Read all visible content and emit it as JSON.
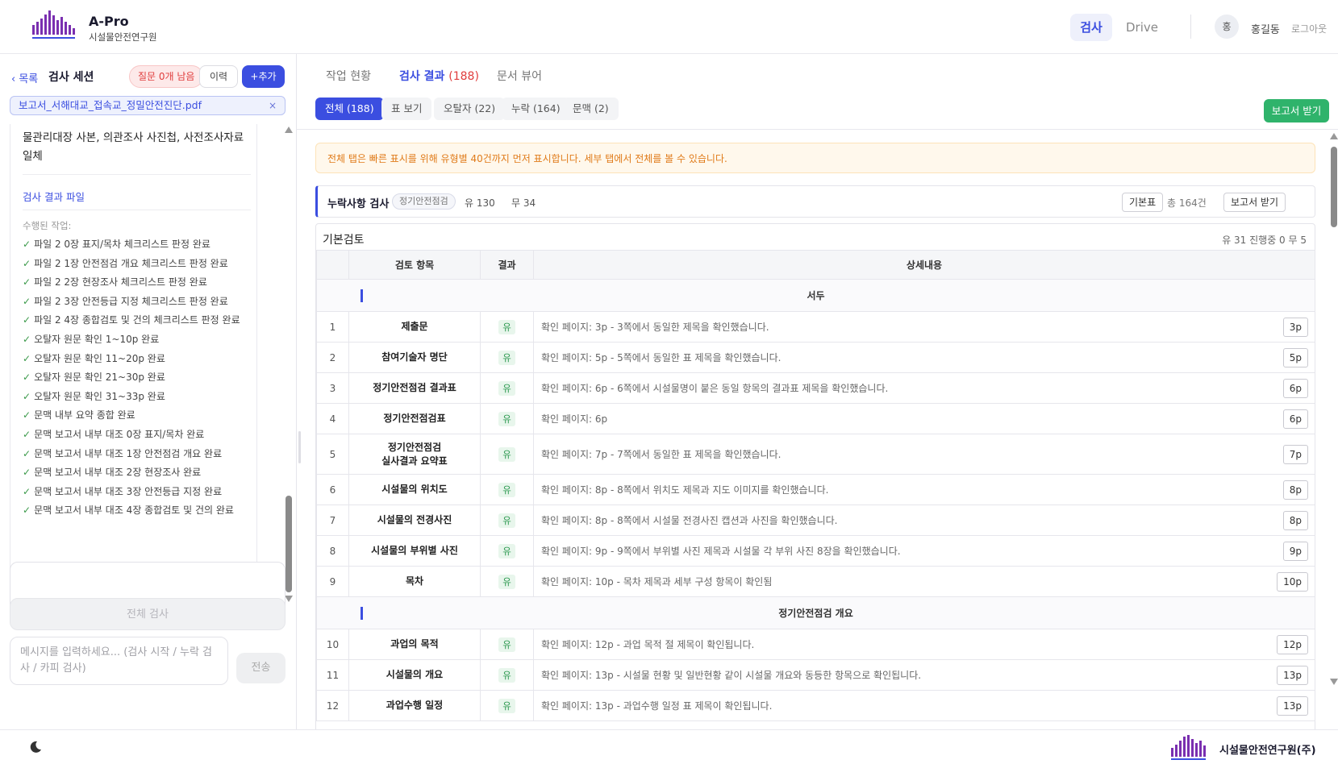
{
  "header": {
    "brand_name": "A-Pro",
    "brand_sub": "시설물안전연구원",
    "nav_active": "검사",
    "nav_drive": "Drive",
    "avatar_initial": "홍",
    "user_name": "홍길동",
    "logout": "로그아웃"
  },
  "left": {
    "back": "목록",
    "session_title": "검사 세션",
    "question_badge": "질문 0개 남음",
    "history_btn": "이력",
    "add_btn": "+추가",
    "file_name": "보고서_서해대교_접속교_정밀안전진단.pdf",
    "file_remove": "×",
    "log_lead": "물관리대장 사본, 의관조사 사진첩, 사전조사자료 일체",
    "result_file_link": "검사 결과 파일",
    "done_label": "수행된 작업:",
    "tasks": [
      "파일 2 0장 표지/목차 체크리스트 판정 완료",
      "파일 2 1장 안전점검 개요 체크리스트 판정 완료",
      "파일 2 2장 현장조사 체크리스트 판정 완료",
      "파일 2 3장 안전등급 지정 체크리스트 판정 완료",
      "파일 2 4장 종합검토 및 건의 체크리스트 판정 완료",
      "오탈자 원문 확인 1~10p 완료",
      "오탈자 원문 확인 11~20p 완료",
      "오탈자 원문 확인 21~30p 완료",
      "오탈자 원문 확인 31~33p 완료",
      "문맥 내부 요약 종합 완료",
      "문맥 보고서 내부 대조 0장 표지/목차 완료",
      "문맥 보고서 내부 대조 1장 안전점검 개요 완료",
      "문맥 보고서 내부 대조 2장 현장조사 완료",
      "문맥 보고서 내부 대조 3장 안전등급 지정 완료",
      "문맥 보고서 내부 대조 4장 종합검토 및 건의 완료"
    ],
    "full_check_btn": "전체 검사",
    "chat_placeholder": "메시지를 입력하세요... (검사 시작 / 누락 검사 / 카피 검사)",
    "send_btn": "전송"
  },
  "main": {
    "tabs": [
      {
        "label": "작업 현황",
        "count": ""
      },
      {
        "label": "검사 결과",
        "count": "(188)"
      },
      {
        "label": "문서 뷰어",
        "count": ""
      }
    ],
    "filters": [
      "전체 (188)",
      "표 보기",
      "오탈자 (22)",
      "누락 (164)",
      "문맥 (2)"
    ],
    "report_btn": "보고서 받기",
    "notice": "전체 탭은 빠른 표시를 위해 유형별 40건까지 먼저 표시합니다. 세부 탭에서 전체를 볼 수 있습니다.",
    "section": {
      "title": "누락사항 검사",
      "tag": "정기안전점검",
      "yes": "유 130",
      "no": "무 34",
      "basic_btn": "기본표",
      "total": "총 164건",
      "report_btn": "보고서 받기"
    },
    "table": {
      "title": "기본검토",
      "stats": "유 31   진행중 0   무 5",
      "headers": [
        "",
        "검토 항목",
        "결과",
        "상세내용"
      ],
      "groups": [
        {
          "name": "서두",
          "rows": [
            {
              "no": "1",
              "item": "제출문",
              "result": "유",
              "detail": "확인 페이지: 3p - 3쪽에서 동일한 제목을 확인했습니다.",
              "page": "3p"
            },
            {
              "no": "2",
              "item": "참여기술자 명단",
              "result": "유",
              "detail": "확인 페이지: 5p - 5쪽에서 동일한 표 제목을 확인했습니다.",
              "page": "5p"
            },
            {
              "no": "3",
              "item": "정기안전점검 결과표",
              "result": "유",
              "detail": "확인 페이지: 6p - 6쪽에서 시설물명이 붙은 동일 항목의 결과표 제목을 확인했습니다.",
              "page": "6p"
            },
            {
              "no": "4",
              "item": "정기안전점검표",
              "result": "유",
              "detail": "확인 페이지: 6p",
              "page": "6p"
            },
            {
              "no": "5",
              "item": "정기안전점검\n실사결과 요약표",
              "result": "유",
              "detail": "확인 페이지: 7p - 7쪽에서 동일한 표 제목을 확인했습니다.",
              "page": "7p"
            },
            {
              "no": "6",
              "item": "시설물의 위치도",
              "result": "유",
              "detail": "확인 페이지: 8p - 8쪽에서 위치도 제목과 지도 이미지를 확인했습니다.",
              "page": "8p"
            },
            {
              "no": "7",
              "item": "시설물의 전경사진",
              "result": "유",
              "detail": "확인 페이지: 8p - 8쪽에서 시설물 전경사진 캡션과 사진을 확인했습니다.",
              "page": "8p"
            },
            {
              "no": "8",
              "item": "시설물의 부위별 사진",
              "result": "유",
              "detail": "확인 페이지: 9p - 9쪽에서 부위별 사진 제목과 시설물 각 부위 사진 8장을 확인했습니다.",
              "page": "9p"
            },
            {
              "no": "9",
              "item": "목차",
              "result": "유",
              "detail": "확인 페이지: 10p - 목차 제목과 세부 구성 항목이 확인됨",
              "page": "10p"
            }
          ]
        },
        {
          "name": "정기안전점검 개요",
          "rows": [
            {
              "no": "10",
              "item": "과업의 목적",
              "result": "유",
              "detail": "확인 페이지: 12p - 과업 목적 절 제목이 확인됩니다.",
              "page": "12p"
            },
            {
              "no": "11",
              "item": "시설물의 개요",
              "result": "유",
              "detail": "확인 페이지: 13p - 시설물 현황 및 일반현황 같이 시설물 개요와 동등한 항목으로 확인됩니다.",
              "page": "13p"
            },
            {
              "no": "12",
              "item": "과업수행 일정",
              "result": "유",
              "detail": "확인 페이지: 13p - 과업수행 일정 표 제목이 확인됩니다.",
              "page": "13p"
            }
          ]
        }
      ]
    }
  },
  "footer": {
    "company": "시설물안전연구원(주)"
  },
  "colors": {
    "accent": "#3b4ee0",
    "success": "#2fb36b",
    "danger": "#e03d3d",
    "warning": "#e07b1a"
  }
}
